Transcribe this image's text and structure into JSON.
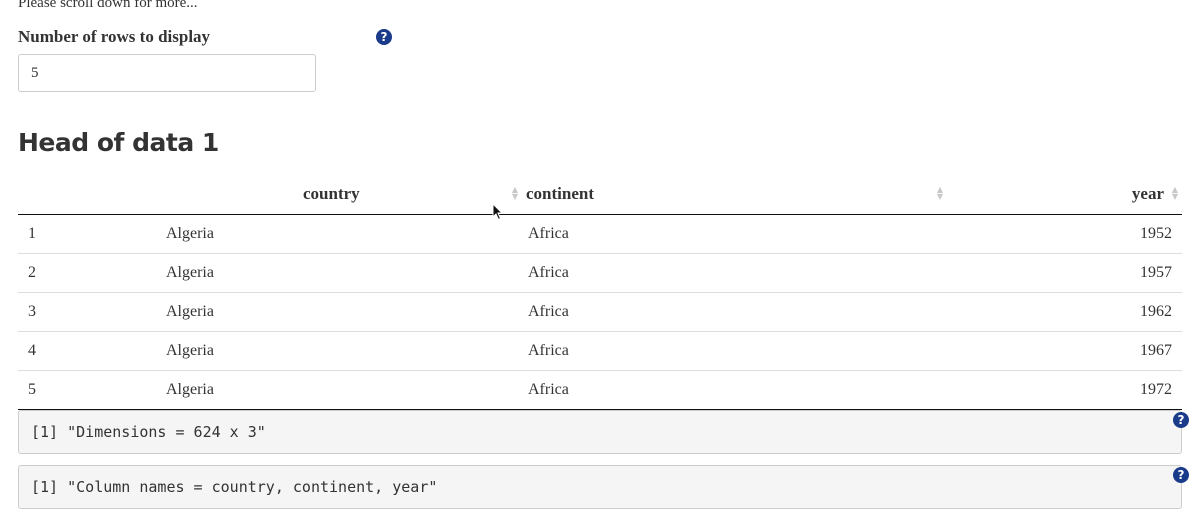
{
  "scroll_hint": "Please scroll down for more...",
  "rows_field": {
    "label": "Number of rows to display",
    "value": "5",
    "help_icon": "question-circle-icon"
  },
  "heading": "Head of data 1",
  "table": {
    "columns": [
      "",
      "country",
      "continent",
      "year"
    ],
    "rows": [
      [
        "1",
        "Algeria",
        "Africa",
        "1952"
      ],
      [
        "2",
        "Algeria",
        "Africa",
        "1957"
      ],
      [
        "3",
        "Algeria",
        "Africa",
        "1962"
      ],
      [
        "4",
        "Algeria",
        "Africa",
        "1967"
      ],
      [
        "5",
        "Algeria",
        "Africa",
        "1972"
      ]
    ]
  },
  "outputs": [
    "[1] \"Dimensions = 624 x 3\"",
    "[1] \"Column names = country, continent, year\""
  ],
  "colors": {
    "help_icon": "#1a3a8a",
    "output_bg": "#f5f5f5"
  }
}
